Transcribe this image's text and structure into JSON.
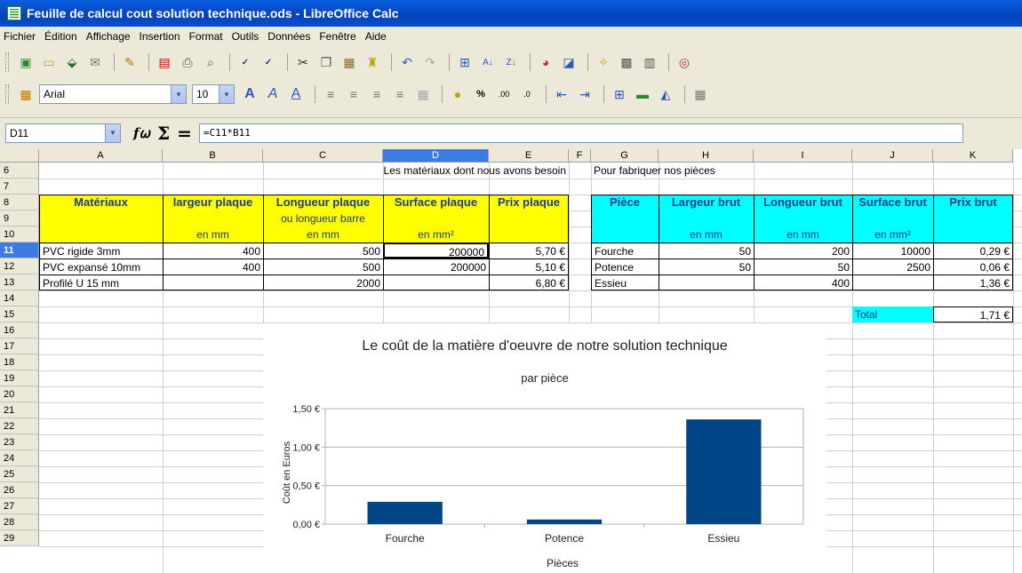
{
  "window": {
    "title": "Feuille de calcul cout solution technique.ods - LibreOffice Calc"
  },
  "menu": [
    "Fichier",
    "Édition",
    "Affichage",
    "Insertion",
    "Format",
    "Outils",
    "Données",
    "Fenêtre",
    "Aide"
  ],
  "formatting": {
    "font_name": "Arial",
    "font_size": "10"
  },
  "formula_bar": {
    "cell_ref": "D11",
    "formula": "=C11*B11"
  },
  "columns": [
    "A",
    "B",
    "C",
    "D",
    "E",
    "F",
    "G",
    "H",
    "I",
    "J",
    "K"
  ],
  "rows": [
    "6",
    "7",
    "8",
    "9",
    "10",
    "11",
    "12",
    "13",
    "14",
    "15",
    "16",
    "17",
    "18",
    "19",
    "20",
    "21",
    "22",
    "23",
    "24",
    "25",
    "26",
    "27",
    "28",
    "29"
  ],
  "sheet": {
    "r6_title_left": "Les matériaux dont nous avons besoin",
    "r6_title_right": "Pour fabriquer nos pièces",
    "hdr": {
      "materiaux": "Matériaux",
      "largeur_plaque": "largeur plaque",
      "longueur_plaque": "Longueur plaque",
      "ou_longueur_barre": "ou longueur barre",
      "surface_plaque": "Surface plaque",
      "prix_plaque": "Prix plaque",
      "piece": "Pièce",
      "largeur_brut": "Largeur brut",
      "longueur_brut": "Longueur brut",
      "surface_brut": "Surface brut",
      "prix_brut": "Prix brut",
      "en_mm": "en mm",
      "en_mm2": "en mm²"
    },
    "materials": [
      {
        "name": "PVC rigide 3mm",
        "largeur": "400",
        "longueur": "500",
        "surface": "200000",
        "prix": "5,70 €"
      },
      {
        "name": "PVC expansé 10mm",
        "largeur": "400",
        "longueur": "500",
        "surface": "200000",
        "prix": "5,10 €"
      },
      {
        "name": "Profilé U 15 mm",
        "largeur": "",
        "longueur": "2000",
        "surface": "",
        "prix": "6,80 €"
      }
    ],
    "pieces": [
      {
        "name": "Fourche",
        "largeur": "50",
        "longueur": "200",
        "surface": "10000",
        "prix": "0,29 €"
      },
      {
        "name": "Potence",
        "largeur": "50",
        "longueur": "50",
        "surface": "2500",
        "prix": "0,06 €"
      },
      {
        "name": "Essieu",
        "largeur": "",
        "longueur": "400",
        "surface": "",
        "prix": "1,36 €"
      }
    ],
    "total_label": "Total",
    "total_value": "1,71 €"
  },
  "chart_data": {
    "type": "bar",
    "title": "Le coût de la matière d'oeuvre de notre solution technique",
    "subtitle": "par pièce",
    "xlabel": "Pièces",
    "ylabel": "Coût en Euros",
    "categories": [
      "Fourche",
      "Potence",
      "Essieu"
    ],
    "values": [
      0.29,
      0.06,
      1.36
    ],
    "ylim": [
      0,
      1.5
    ],
    "yticks": [
      "0,00 €",
      "0,50 €",
      "1,00 €",
      "1,50 €"
    ],
    "bar_color": "#004586",
    "grid": true
  }
}
